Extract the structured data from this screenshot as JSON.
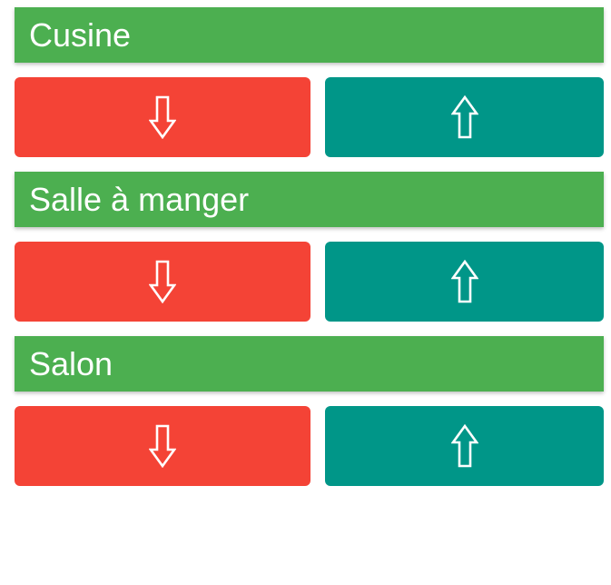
{
  "colors": {
    "header": "#4caf50",
    "down_button": "#f44336",
    "up_button": "#009688",
    "text": "#ffffff"
  },
  "rooms": [
    {
      "name": "Cusine",
      "down_icon": "arrow-down-outline-icon",
      "up_icon": "arrow-up-outline-icon"
    },
    {
      "name": "Salle à manger",
      "down_icon": "arrow-down-outline-icon",
      "up_icon": "arrow-up-outline-icon"
    },
    {
      "name": "Salon",
      "down_icon": "arrow-down-outline-icon",
      "up_icon": "arrow-up-outline-icon"
    }
  ]
}
